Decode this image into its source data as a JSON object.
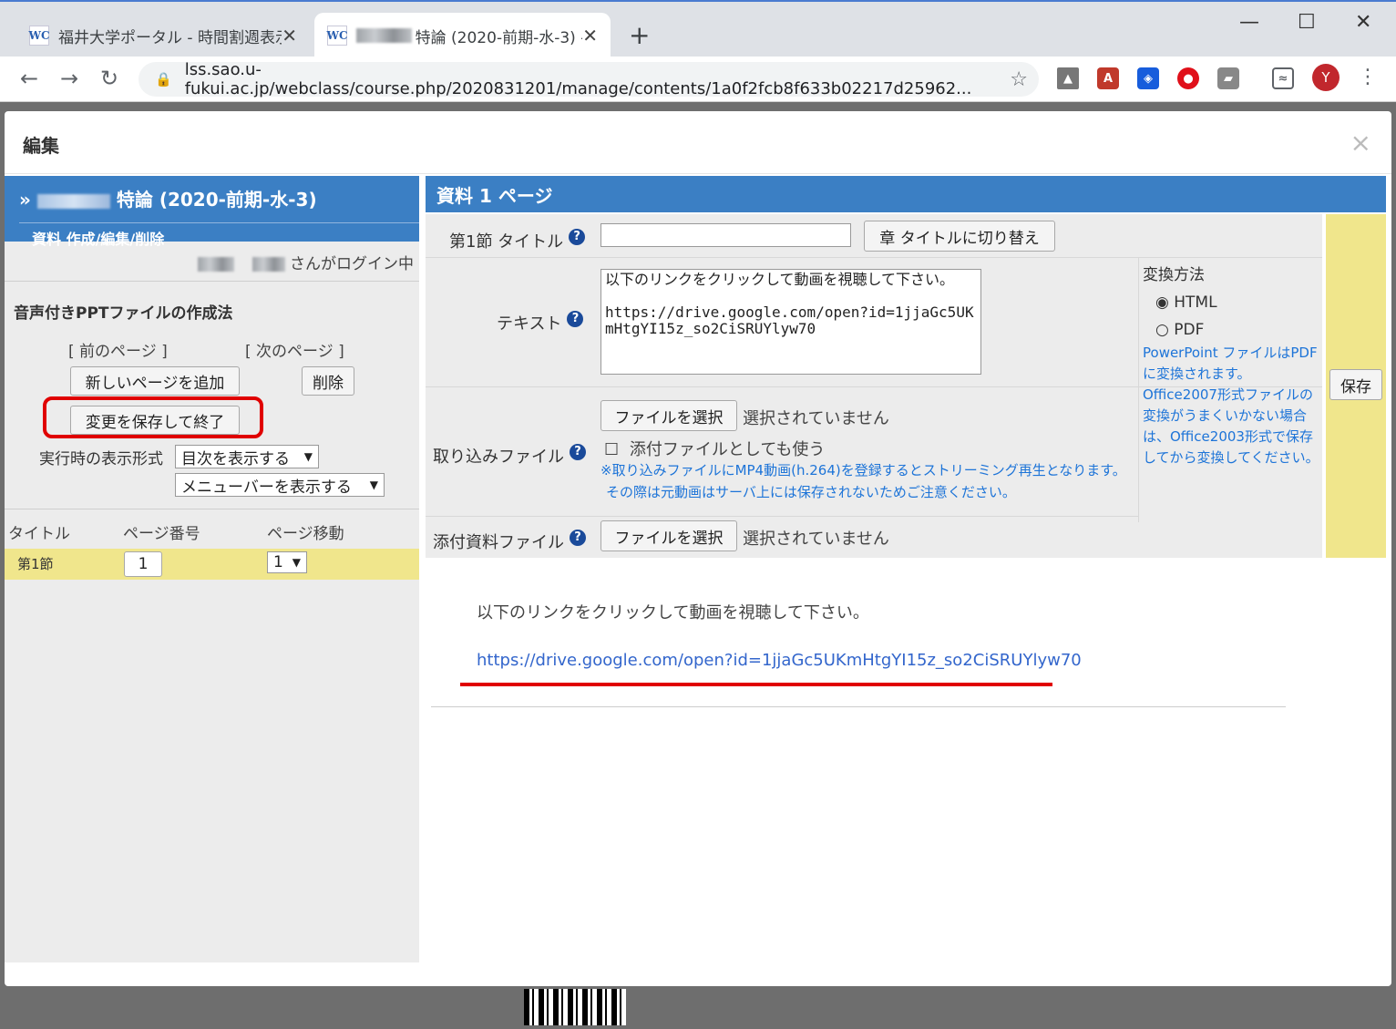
{
  "browser": {
    "tabs": [
      {
        "title": "福井大学ポータル - 時間割週表示",
        "active": false
      },
      {
        "title": "特論 (2020-前期-水-3) -",
        "active": true
      }
    ],
    "url": "lss.sao.u-fukui.ac.jp/webclass/course.php/2020831201/manage/contents/1a0f2fcb8f633b02217d25962...",
    "avatar_initial": "Y",
    "new_tab": "+",
    "close_glyph": "✕",
    "icons": [
      "back-icon",
      "forward-icon",
      "reload-icon",
      "lock-icon",
      "star-icon",
      "drive-icon",
      "acrobat-icon",
      "bitwarden-icon",
      "extension-icon",
      "chat-icon",
      "cast-icon",
      "menu-icon"
    ]
  },
  "dialog": {
    "title": "編集",
    "close": "×"
  },
  "left": {
    "course_prefix": "»",
    "course_name": "特論 (2020-前期-水-3)",
    "subtitle": "資料 作成/編集/削除",
    "login_suffix": "さんがログイン中",
    "section_title": "音声付きPPTファイルの作成法",
    "prev_page": "[ 前のページ ]",
    "next_page": "[ 次のページ ]",
    "add_page_button": "新しいページを追加",
    "delete_button": "削除",
    "save_exit_button": "変更を保存して終了",
    "display_format_label": "実行時の表示形式",
    "toc_select": "目次を表示する",
    "menubar_select": "メニューバーを表示する",
    "table": {
      "headers": [
        "タイトル",
        "ページ番号",
        "ページ移動"
      ],
      "rows": [
        {
          "title": "第1節",
          "page_number": "1",
          "move": "1"
        }
      ]
    }
  },
  "right": {
    "header": "資料 1 ページ",
    "section_title_label": "第1節 タイトル",
    "section_title_value": "",
    "chapter_toggle_button": "章 タイトルに切り替え",
    "text_label": "テキスト",
    "text_value": "以下のリンクをクリックして動画を視聴して下さい。\n\nhttps://drive.google.com/open?id=1jjaGc5UKmHtgYI15z_so2CiSRUYlyw70",
    "conversion": {
      "label": "変換方法",
      "options": [
        "HTML",
        "PDF"
      ],
      "selected": "HTML",
      "note": "PowerPoint ファイルはPDFに変換されます。Office2007形式ファイルの変換がうまくいかない場合は、Office2003形式で保存してから変換してください。"
    },
    "import_label": "取り込みファイル",
    "file_button": "ファイルを選択",
    "no_file": "選択されていません",
    "attach_checkbox": "添付ファイルとしても使う",
    "import_note_1": "※取り込みファイルにMP4動画(h.264)を登録するとストリーミング再生となります。",
    "import_note_2": "その際は元動画はサーバ上には保存されないためご注意ください。",
    "attach_label": "添付資料ファイル",
    "save_button": "保存",
    "help_glyph": "?"
  },
  "preview": {
    "text": "以下のリンクをクリックして動画を視聴して下さい。",
    "link": "https://drive.google.com/open?id=1jjaGc5UKmHtgYI15z_so2CiSRUYlyw70"
  },
  "colors": {
    "header_blue": "#3b7fc4",
    "highlight_yellow": "#f0e68c",
    "annotation_red": "#e00000",
    "link_blue": "#3366cc"
  }
}
